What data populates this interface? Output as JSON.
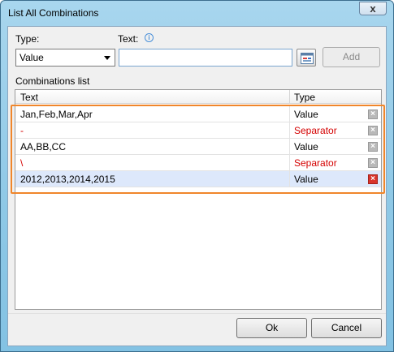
{
  "window": {
    "title": "List All Combinations",
    "close_glyph": "x"
  },
  "form": {
    "type_label": "Type:",
    "text_label": "Text:",
    "info_glyph": "i",
    "type_value": "Value",
    "text_value": "",
    "add_label": "Add"
  },
  "list": {
    "group_label": "Combinations list",
    "col_text": "Text",
    "col_type": "Type",
    "rows": [
      {
        "text": "Jan,Feb,Mar,Apr",
        "type": "Value",
        "kind": "value"
      },
      {
        "text": "-",
        "type": "Separator",
        "kind": "separator"
      },
      {
        "text": "AA,BB,CC",
        "type": "Value",
        "kind": "value"
      },
      {
        "text": "\\",
        "type": "Separator",
        "kind": "separator"
      },
      {
        "text": "2012,2013,2014,2015",
        "type": "Value",
        "kind": "value",
        "selected": true
      }
    ],
    "delete_glyph": "×"
  },
  "buttons": {
    "ok": "Ok",
    "cancel": "Cancel"
  },
  "colors": {
    "separator_text": "#d40000",
    "highlight_border": "#f0862b",
    "selected_row": "#dde8fb"
  }
}
